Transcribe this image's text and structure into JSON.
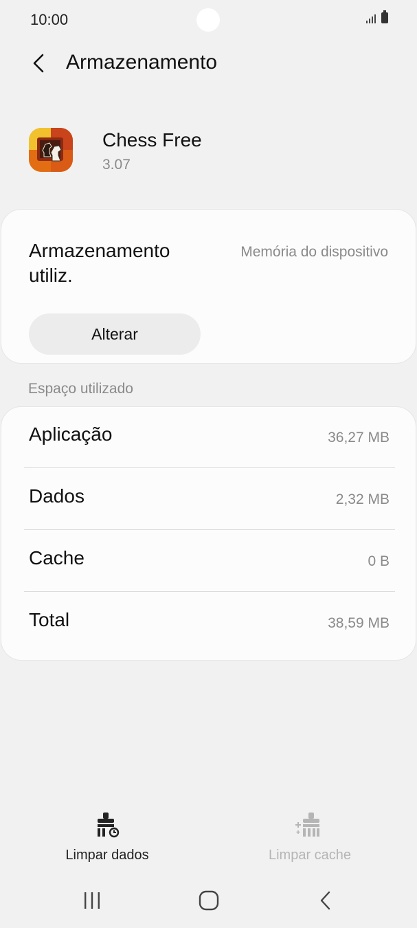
{
  "status_bar": {
    "time": "10:00",
    "icons": [
      "signal-icon",
      "battery-icon"
    ]
  },
  "header": {
    "back_icon": "back-arrow-icon",
    "title": "Armazenamento"
  },
  "app": {
    "icon": "chess-free-app-icon",
    "name": "Chess Free",
    "version": "3.07"
  },
  "storage_location": {
    "label": "Armazenamento utiliz.",
    "value": "Memória do dispositivo",
    "change_button": "Alterar"
  },
  "usage": {
    "section_title": "Espaço utilizado",
    "rows": [
      {
        "label": "Aplicação",
        "value": "36,27 MB"
      },
      {
        "label": "Dados",
        "value": "2,32 MB"
      },
      {
        "label": "Cache",
        "value": "0 B"
      },
      {
        "label": "Total",
        "value": "38,59 MB"
      }
    ]
  },
  "actions": {
    "clear_data": {
      "label": "Limpar dados",
      "icon": "clear-data-icon",
      "enabled": true
    },
    "clear_cache": {
      "label": "Limpar cache",
      "icon": "clear-cache-icon",
      "enabled": false
    }
  },
  "nav_bar": {
    "icons": [
      "recent-apps-icon",
      "home-icon",
      "back-icon"
    ]
  },
  "colors": {
    "background": "#f1f1f1",
    "card": "#fcfcfc",
    "secondary_text": "#8a8a8a",
    "disabled_text": "#b5b5b5"
  }
}
